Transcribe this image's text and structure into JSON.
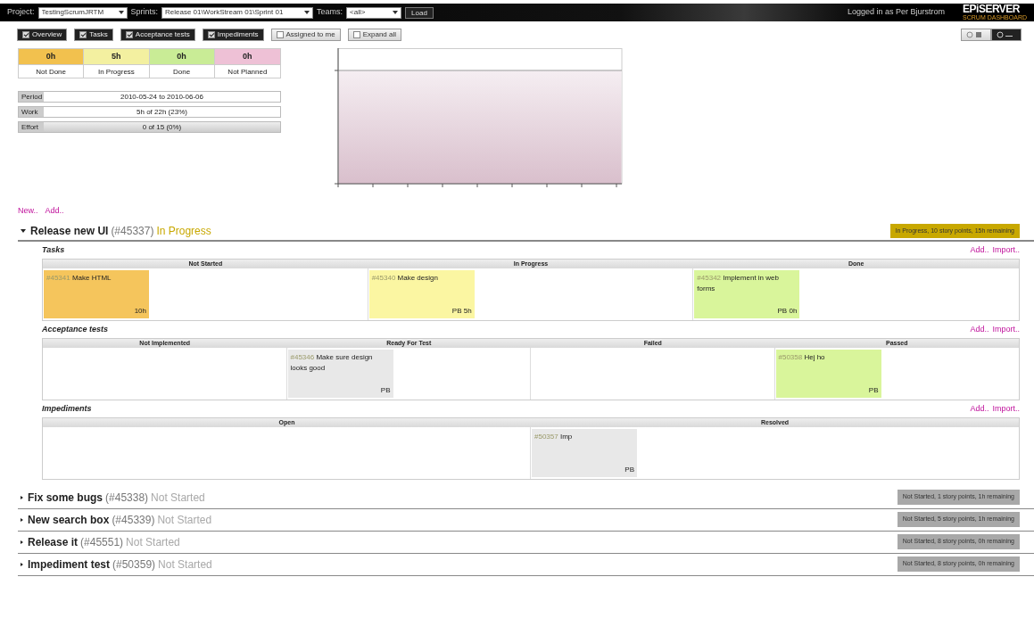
{
  "topbar": {
    "project_label": "Project:",
    "project": "TestingScrumJRTM",
    "sprints_label": "Sprints:",
    "sprint": "Release 01\\WorkStream 01\\Sprint 01",
    "teams_label": "Teams:",
    "team": "<all>",
    "load_button": "Load",
    "user": "Logged in as Per Bjurstrom",
    "logo": "EPiSERVER",
    "logo_sub": "SCRUM DASHBOARD"
  },
  "toggles": [
    {
      "label": "Overview",
      "checked": true
    },
    {
      "label": "Tasks",
      "checked": true
    },
    {
      "label": "Acceptance tests",
      "checked": true
    },
    {
      "label": "Impediments",
      "checked": true
    },
    {
      "label": "Assigned to me",
      "checked": false
    },
    {
      "label": "Expand all",
      "checked": false
    }
  ],
  "view_switch": [
    {
      "kind": "list",
      "selected": false
    },
    {
      "kind": "compact",
      "selected": true
    }
  ],
  "summary": [
    {
      "hours": "0h",
      "label": "Not Done",
      "color": "#f2c14e"
    },
    {
      "hours": "5h",
      "label": "In Progress",
      "color": "#f3f0a0"
    },
    {
      "hours": "0h",
      "label": "Done",
      "color": "#c9ec96"
    },
    {
      "hours": "0h",
      "label": "Not Planned",
      "color": "#eec1d6"
    }
  ],
  "info": [
    {
      "label": "Period",
      "value": "2010-05-24 to 2010-06-06",
      "kind": "text"
    },
    {
      "label": "Work",
      "value": "5h of 22h (23%)",
      "kind": "text"
    },
    {
      "label": "Effort",
      "value": "0 of 15 (0%)",
      "kind": "shaded"
    }
  ],
  "links": [
    "New..",
    "Add.."
  ],
  "stories": [
    {
      "title": "Release new UI",
      "id": "(#45337)",
      "status": "In Progress",
      "color": "#c8a800",
      "expanded": true,
      "summary": "In Progress, 10 story points, 15h remaining",
      "boards": [
        {
          "title": "Tasks",
          "links": [
            "Add..",
            "Import.."
          ],
          "columns": [
            {
              "name": "Not Started",
              "cards": [
                {
                  "id": "#45341",
                  "title": "Make HTML",
                  "footer": "10h",
                  "color": "#f5c55c"
                }
              ]
            },
            {
              "name": "In Progress",
              "cards": [
                {
                  "id": "#45340",
                  "title": "Make design",
                  "footer": "PB 5h",
                  "color": "#fbf6a2"
                }
              ]
            },
            {
              "name": "Done",
              "cards": [
                {
                  "id": "#45342",
                  "title": "Implement in web forms",
                  "footer": "PB 0h",
                  "color": "#d9f59b"
                }
              ]
            }
          ]
        },
        {
          "title": "Acceptance tests",
          "links": [
            "Add..",
            "Import.."
          ],
          "columns": [
            {
              "name": "Not Implemented"
            },
            {
              "name": "Ready For Test",
              "cards": [
                {
                  "id": "#45346",
                  "title": "Make sure design looks good",
                  "footer": "PB",
                  "color": "#e8e8e8"
                }
              ]
            },
            {
              "name": "Failed"
            },
            {
              "name": "Passed",
              "cards": [
                {
                  "id": "#50358",
                  "title": "Hej ho",
                  "footer": "PB",
                  "color": "#d9f59b"
                }
              ]
            }
          ]
        },
        {
          "title": "Impediments",
          "links": [
            "Add..",
            "Import.."
          ],
          "columns": [
            {
              "name": "Open"
            },
            {
              "name": "Resolved",
              "cards": [
                {
                  "id": "#50357",
                  "title": "Imp",
                  "footer": "PB",
                  "color": "#e8e8e8"
                }
              ]
            }
          ]
        }
      ]
    },
    {
      "title": "Fix some bugs",
      "id": "(#45338)",
      "status": "Not Started",
      "color": "#a8a8a8",
      "expanded": false,
      "summary": "Not Started, 1 story points, 1h remaining"
    },
    {
      "title": "New search box",
      "id": "(#45339)",
      "status": "Not Started",
      "color": "#a8a8a8",
      "expanded": false,
      "summary": "Not Started, 5 story points, 1h remaining"
    },
    {
      "title": "Release it",
      "id": "(#45551)",
      "status": "Not Started",
      "color": "#a8a8a8",
      "expanded": false,
      "summary": "Not Started, 8 story points, 0h remaining"
    },
    {
      "title": "Impediment test",
      "id": "(#50359)",
      "status": "Not Started",
      "color": "#a8a8a8",
      "expanded": false,
      "summary": "Not Started, 8 story points, 0h remaining"
    }
  ]
}
